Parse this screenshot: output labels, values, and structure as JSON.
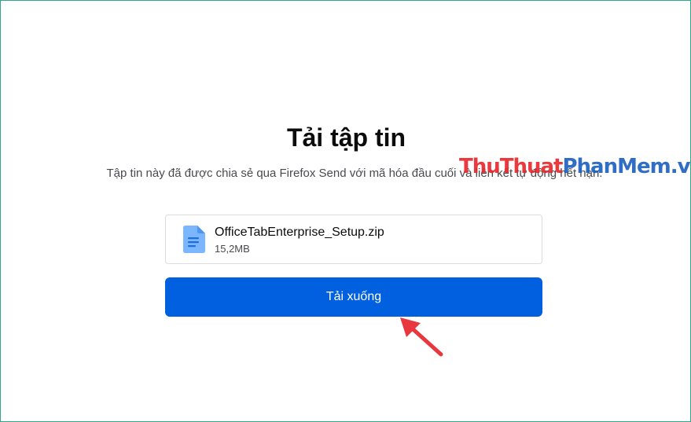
{
  "page": {
    "title": "Tải tập tin",
    "description": "Tập tin này đã được chia sẻ qua Firefox Send với mã hóa đầu cuối và liên kết tự động hết hạn."
  },
  "file": {
    "name": "OfficeTabEnterprise_Setup.zip",
    "size": "15,2MB",
    "icon": "document-icon"
  },
  "actions": {
    "download_label": "Tải xuống"
  },
  "watermark": {
    "brand_part1": "ThuThuat",
    "brand_part2": "PhanMem.vn"
  },
  "colors": {
    "accent": "#0060df",
    "annotation_arrow": "#e8373d",
    "file_icon": "#7bb6ff"
  }
}
